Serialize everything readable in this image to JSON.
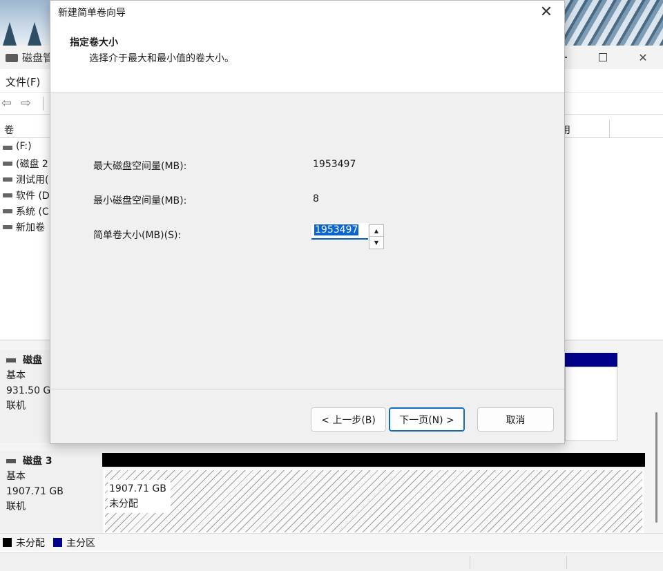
{
  "wizard": {
    "title": "新建简单卷向导",
    "heading": "指定卷大小",
    "subheading": "选择介于最大和最小值的卷大小。",
    "max_label": "最大磁盘空间量(MB):",
    "max_value": "1953497",
    "min_label": "最小磁盘空间量(MB):",
    "min_value": "8",
    "size_label": "简单卷大小(MB)(S):",
    "size_value": "1953497",
    "back_label": "< 上一步(B)",
    "next_label": "下一页(N) >",
    "cancel_label": "取消"
  },
  "disk_mgmt": {
    "title": "磁盘管",
    "menu_file": "文件(F)",
    "column_volume": "卷",
    "column_right": "用",
    "volumes": [
      {
        "name": "(F:)"
      },
      {
        "name": "(磁盘 2"
      },
      {
        "name": "测试用("
      },
      {
        "name": "软件 (D"
      },
      {
        "name": "系统 (C"
      },
      {
        "name": "新加卷"
      }
    ],
    "disks": [
      {
        "name": "磁盘",
        "type": "基本",
        "size": "931.50 G",
        "status": "联机"
      },
      {
        "name": "磁盘 3",
        "type": "基本",
        "size": "1907.71 GB",
        "status": "联机"
      }
    ],
    "unallocated_size": "1907.71 GB",
    "unallocated_label": "未分配",
    "legend": {
      "unallocated": "未分配",
      "primary": "主分区"
    }
  },
  "colors": {
    "unallocated": "#000000",
    "primary_partition": "#00008b",
    "accent": "#0f6cbd"
  },
  "icons": [
    "close-icon",
    "back-arrow-icon",
    "forward-arrow-icon",
    "disk-icon",
    "spin-up-icon",
    "spin-down-icon",
    "minimize-icon",
    "maximize-icon"
  ]
}
